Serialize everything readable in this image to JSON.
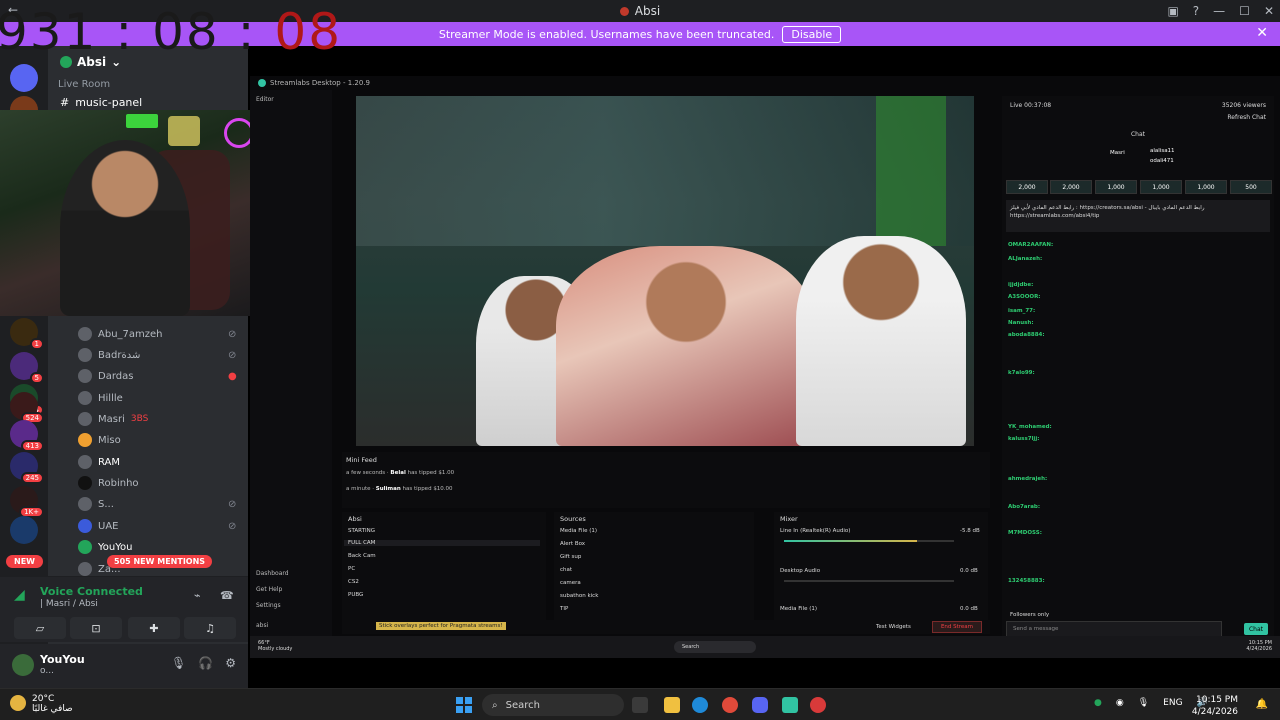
{
  "titlebar": {
    "title": "Absi",
    "back": "←"
  },
  "banner": {
    "message": "Streamer Mode is enabled. Usernames have been truncated.",
    "disable_label": "Disable"
  },
  "timer": {
    "days": "931",
    "hours": "08",
    "minutes": "08",
    "sep": ":"
  },
  "rail": {
    "badges": [
      "1",
      "5",
      "4",
      "524",
      "413",
      "245",
      "1K+"
    ],
    "new_label": "NEW"
  },
  "server": {
    "name": "Absi",
    "category": "Live Room",
    "channel": "music-panel"
  },
  "members": [
    {
      "name": "Abu_7amzeh",
      "tag": ""
    },
    {
      "name": "Badrشدة",
      "tag": ""
    },
    {
      "name": "Dardas",
      "tag": ""
    },
    {
      "name": "Hillle",
      "tag": ""
    },
    {
      "name": "Masri",
      "tag": "3BS"
    },
    {
      "name": "Miso",
      "tag": ""
    },
    {
      "name": "RAM",
      "tag": ""
    },
    {
      "name": "Robinho",
      "tag": ""
    },
    {
      "name": "S...",
      "tag": ""
    },
    {
      "name": "UAE",
      "tag": ""
    },
    {
      "name": "YouYou",
      "tag": ""
    },
    {
      "name": "Za...",
      "tag": ""
    }
  ],
  "mentions": "505 NEW MENTIONS",
  "voice": {
    "title": "Voice Connected",
    "sub": "| Masri / Absi"
  },
  "user": {
    "name": "YouYou",
    "status": "o..."
  },
  "streamlabs": {
    "title": "Streamlabs Desktop - 1.20.9",
    "nav": [
      "Editor",
      "Dashboard",
      "Get Help",
      "Settings",
      "absi"
    ],
    "chat": {
      "live": "Live 00:37:08",
      "viewers": "35206 viewers",
      "refresh": "Refresh Chat",
      "title": "Chat",
      "top": [
        "Masri",
        "alalisa11",
        "odali471"
      ],
      "gifts": [
        "2,000",
        "2,000",
        "1,000",
        "1,000",
        "1,000",
        "500"
      ],
      "pinned": "رابط الدعم المادي لأبي فيلز : https://creators.sa/absi - رابط الدعم المادي بايبال https://streamlabs.com/absi4/tip",
      "lines": [
        "OMAR2AAFAN:",
        "ALJanazeh:",
        "ijjdjdbe:",
        "A3SOOOR:",
        "isam_77:",
        "Nanush:",
        "aboda8884:",
        "k7alo99:",
        "YK_mohamed:",
        "kaluss7ljj:",
        "ahmedrajeh:",
        "Abo7arab:",
        "M7MDOSS:",
        "132458883:"
      ],
      "followers": "Followers only",
      "placeholder": "Send a message",
      "send": "Chat"
    },
    "minifeed": {
      "title": "Mini Feed",
      "rows": [
        {
          "time": "a few seconds",
          "user": "Belal",
          "action": "has tipped",
          "amount": "$1.00"
        },
        {
          "time": "a minute",
          "user": "Suliman",
          "action": "has tipped",
          "amount": "$10.00"
        }
      ]
    },
    "scenes": {
      "title": "Absi",
      "items": [
        "STARTING",
        "FULL CAM",
        "Back Cam",
        "PC",
        "CS2",
        "PUBG"
      ]
    },
    "sources": {
      "title": "Sources",
      "items": [
        "Media File (1)",
        "Alert Box",
        "Gift sup",
        "chat",
        "camera",
        "subathon kick",
        "TIP"
      ]
    },
    "mixer": {
      "title": "Mixer",
      "items": [
        {
          "name": "Line In (Realtek(R) Audio)",
          "db": "-5.8 dB",
          "level": 0.78
        },
        {
          "name": "Desktop Audio",
          "db": "0.0 dB",
          "level": 0.0
        },
        {
          "name": "Media File (1)",
          "db": "0.0 dB",
          "level": 0.0
        }
      ]
    },
    "status": {
      "tip": "Stick overlays perfect for Pragmata streams!",
      "test": "Test Widgets",
      "end": "End Stream"
    }
  },
  "inner_taskbar": {
    "temp": "66°F",
    "weather": "Mostly cloudy",
    "search": "Search",
    "time": "10:15 PM",
    "date": "4/24/2026"
  },
  "taskbar": {
    "temp": "20°C",
    "weather": "صافي غالبًا",
    "search": "Search",
    "lang": "ENG",
    "time": "10:15 PM",
    "date": "4/24/2026"
  }
}
